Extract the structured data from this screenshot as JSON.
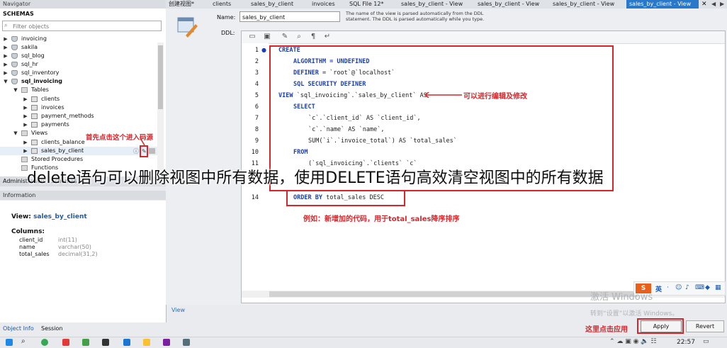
{
  "navigator": {
    "header": "Navigator",
    "schemas_title": "SCHEMAS",
    "filter_placeholder": "Filter objects",
    "schemas": [
      "invoicing",
      "sakila",
      "sql_blog",
      "sql_hr",
      "sql_inventory",
      "sql_invoicing"
    ],
    "tables_folder": "Tables",
    "tables": [
      "clients",
      "invoices",
      "payment_methods",
      "payments"
    ],
    "views_folder": "Views",
    "views": [
      "clients_balance",
      "sales_by_client"
    ],
    "stored_procedures": "Stored Procedures",
    "functions": "Functions"
  },
  "admin_tabs": {
    "administration": "Administration",
    "schemas": "Schemas"
  },
  "info": {
    "header": "Information",
    "view_label": "View:",
    "view_name": "sales_by_client",
    "columns_label": "Columns:",
    "columns": [
      {
        "name": "client_id",
        "type": "int(11)"
      },
      {
        "name": "name",
        "type": "varchar(50)"
      },
      {
        "name": "total_sales",
        "type": "decimal(31,2)"
      }
    ]
  },
  "bottom_tabs": {
    "object_info": "Object Info",
    "session": "Session"
  },
  "tabs": [
    "创建视图*",
    "clients",
    "sales_by_client",
    "invoices",
    "SQL File 12*",
    "sales_by_client - View",
    "sales_by_client - View",
    "sales_by_client - View",
    "sales_by_client - View"
  ],
  "editor": {
    "name_label": "Name:",
    "name_value": "sales_by_client",
    "name_help": "The name of the view is parsed automatically from the DDL statement. The DDL is parsed automatically while you type.",
    "ddl_label": "DDL:",
    "lines": [
      {
        "n": "1",
        "kw": "CREATE",
        "rest": ""
      },
      {
        "n": "2",
        "kw": "ALGORITHM = UNDEFINED",
        "rest": ""
      },
      {
        "n": "3",
        "kw": "DEFINER",
        "rest": " = `root`@`localhost`"
      },
      {
        "n": "4",
        "kw": "SQL SECURITY DEFINER",
        "rest": ""
      },
      {
        "n": "5",
        "kw": "VIEW",
        "rest": " `sql_invoicing`.`sales_by_client` AS"
      },
      {
        "n": "6",
        "kw": "SELECT",
        "rest": ""
      },
      {
        "n": "7",
        "kw": "",
        "rest": "`c`.`client_id` AS `client_id`,"
      },
      {
        "n": "8",
        "kw": "",
        "rest": "`c`.`name` AS `name`,"
      },
      {
        "n": "9",
        "kw": "",
        "rest": "SUM(`i`.`invoice_total`) AS `total_sales`"
      },
      {
        "n": "10",
        "kw": "FROM",
        "rest": ""
      },
      {
        "n": "11",
        "kw": "",
        "rest": "(`sql_invoicing`.`clients` `c`"
      },
      {
        "n": "14",
        "kw": "ORDER BY",
        "rest": " total_sales DESC"
      }
    ],
    "view_tab": "View"
  },
  "annotations": {
    "click_here": "首先点击这个进入码源",
    "editable": "可以进行编辑及修改",
    "example": "例如：新增加的代码，用于total_sales降序排序",
    "apply_here": "这里点击应用"
  },
  "caption": "delete语句可以删除视图中所有数据，使用DELETE语句高效清空视图中的所有数据",
  "buttons": {
    "apply": "Apply",
    "revert": "Revert"
  },
  "watermark": {
    "line1": "激活 Windows",
    "line2": "转到“设置”以激活 Windows。"
  },
  "clock": "22:57"
}
